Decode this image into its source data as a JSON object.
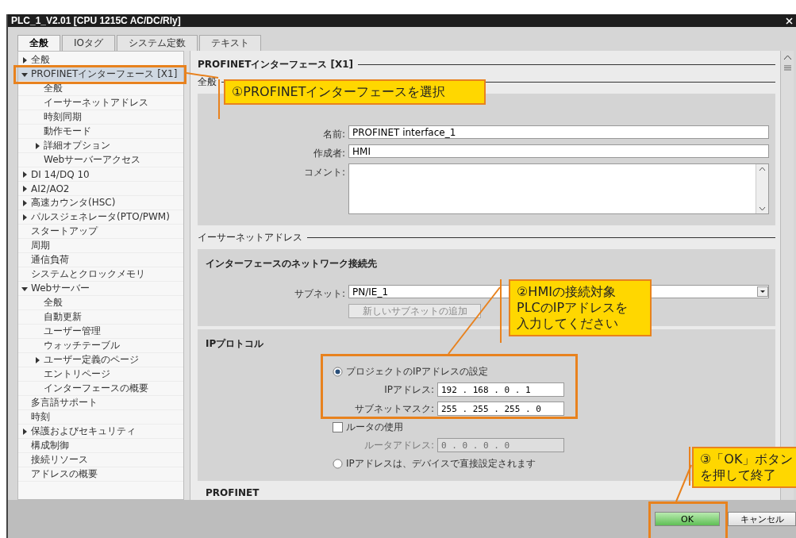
{
  "window": {
    "title": "PLC_1_V2.01 [CPU 1215C AC/DC/Rly]"
  },
  "tabs": [
    {
      "label": "全般",
      "selected": true
    },
    {
      "label": "IOタグ",
      "selected": false
    },
    {
      "label": "システム定数",
      "selected": false
    },
    {
      "label": "テキスト",
      "selected": false
    }
  ],
  "tree": [
    {
      "label": "全般",
      "expanded": false,
      "selected": false
    },
    {
      "label": "PROFINETインターフェース [X1]",
      "expanded": true,
      "selected": true,
      "children": [
        {
          "label": "全般",
          "selected": false
        },
        {
          "label": "イーサーネットアドレス",
          "selected": false
        },
        {
          "label": "時刻同期",
          "selected": false
        },
        {
          "label": "動作モード",
          "selected": false
        },
        {
          "label": "詳細オプション",
          "expanded": false,
          "selected": false
        },
        {
          "label": "Webサーバーアクセス",
          "selected": false
        }
      ]
    },
    {
      "label": "DI 14/DQ 10",
      "expanded": false,
      "selected": false
    },
    {
      "label": "AI2/AO2",
      "expanded": false,
      "selected": false
    },
    {
      "label": "高速カウンタ(HSC)",
      "expanded": false,
      "selected": false
    },
    {
      "label": "パルスジェネレータ(PTO/PWM)",
      "expanded": false,
      "selected": false
    },
    {
      "label": "スタートアップ",
      "selected": false
    },
    {
      "label": "周期",
      "selected": false
    },
    {
      "label": "通信負荷",
      "selected": false
    },
    {
      "label": "システムとクロックメモリ",
      "selected": false
    },
    {
      "label": "Webサーバー",
      "expanded": true,
      "selected": false,
      "children": [
        {
          "label": "全般",
          "selected": false
        },
        {
          "label": "自動更新",
          "selected": false
        },
        {
          "label": "ユーザー管理",
          "selected": false
        },
        {
          "label": "ウォッチテーブル",
          "selected": false
        },
        {
          "label": "ユーザー定義のページ",
          "expanded": false,
          "selected": false
        },
        {
          "label": "エントリページ",
          "selected": false
        },
        {
          "label": "インターフェースの概要",
          "selected": false
        }
      ]
    },
    {
      "label": "多言語サポート",
      "selected": false
    },
    {
      "label": "時刻",
      "selected": false
    },
    {
      "label": "保護およびセキュリティ",
      "expanded": false,
      "selected": false
    },
    {
      "label": "構成制御",
      "selected": false
    },
    {
      "label": "接続リソース",
      "selected": false
    },
    {
      "label": "アドレスの概要",
      "selected": false
    }
  ],
  "content": {
    "heading": "PROFINETインターフェース [X1]",
    "general": {
      "heading": "全般",
      "fields": [
        {
          "kind": "text",
          "label": "名前:",
          "value": "PROFINET interface_1"
        },
        {
          "kind": "text",
          "label": "作成者:",
          "value": "HMI"
        },
        {
          "kind": "textarea",
          "label": "コメント:"
        }
      ]
    },
    "ethernet": {
      "heading": "イーサーネットアドレス",
      "network": {
        "title": "インターフェースのネットワーク接続先",
        "subnet_label": "サブネット:",
        "subnet_value": "PN/IE_1",
        "add_button": {
          "label": "新しいサブネットの追加",
          "disabled": true
        }
      },
      "ip_protocol": {
        "title": "IPプロトコル",
        "options": [
          {
            "kind": "radio",
            "label": "プロジェクトのIPアドレスの設定",
            "selected": true
          },
          {
            "kind": "field",
            "label": "IPアドレス:",
            "value": "192 . 168 . 0 . 1",
            "disabled": false
          },
          {
            "kind": "field",
            "label": "サブネットマスク:",
            "value": "255 . 255 . 255 . 0",
            "disabled": false
          },
          {
            "kind": "checkbox",
            "label": "ルータの使用",
            "checked": false
          },
          {
            "kind": "field",
            "label": "ルータアドレス:",
            "value": "0 . 0 . 0 . 0",
            "disabled": true
          },
          {
            "kind": "radio",
            "label": "IPアドレスは、デバイスで直接設定されます",
            "selected": false
          }
        ]
      }
    },
    "profinet_heading": "PROFINET"
  },
  "buttons": [
    {
      "kind": "primary",
      "label": "OK"
    },
    {
      "kind": "secondary",
      "label": "キャンセル"
    }
  ],
  "callouts": [
    {
      "lines": [
        "①PROFINETインターフェースを選択"
      ]
    },
    {
      "lines": [
        "②HMIの接続対象",
        "PLCのIPアドレスを",
        "入力してください"
      ]
    },
    {
      "lines": [
        "③「OK」ボタン",
        "を押して終了"
      ]
    }
  ]
}
